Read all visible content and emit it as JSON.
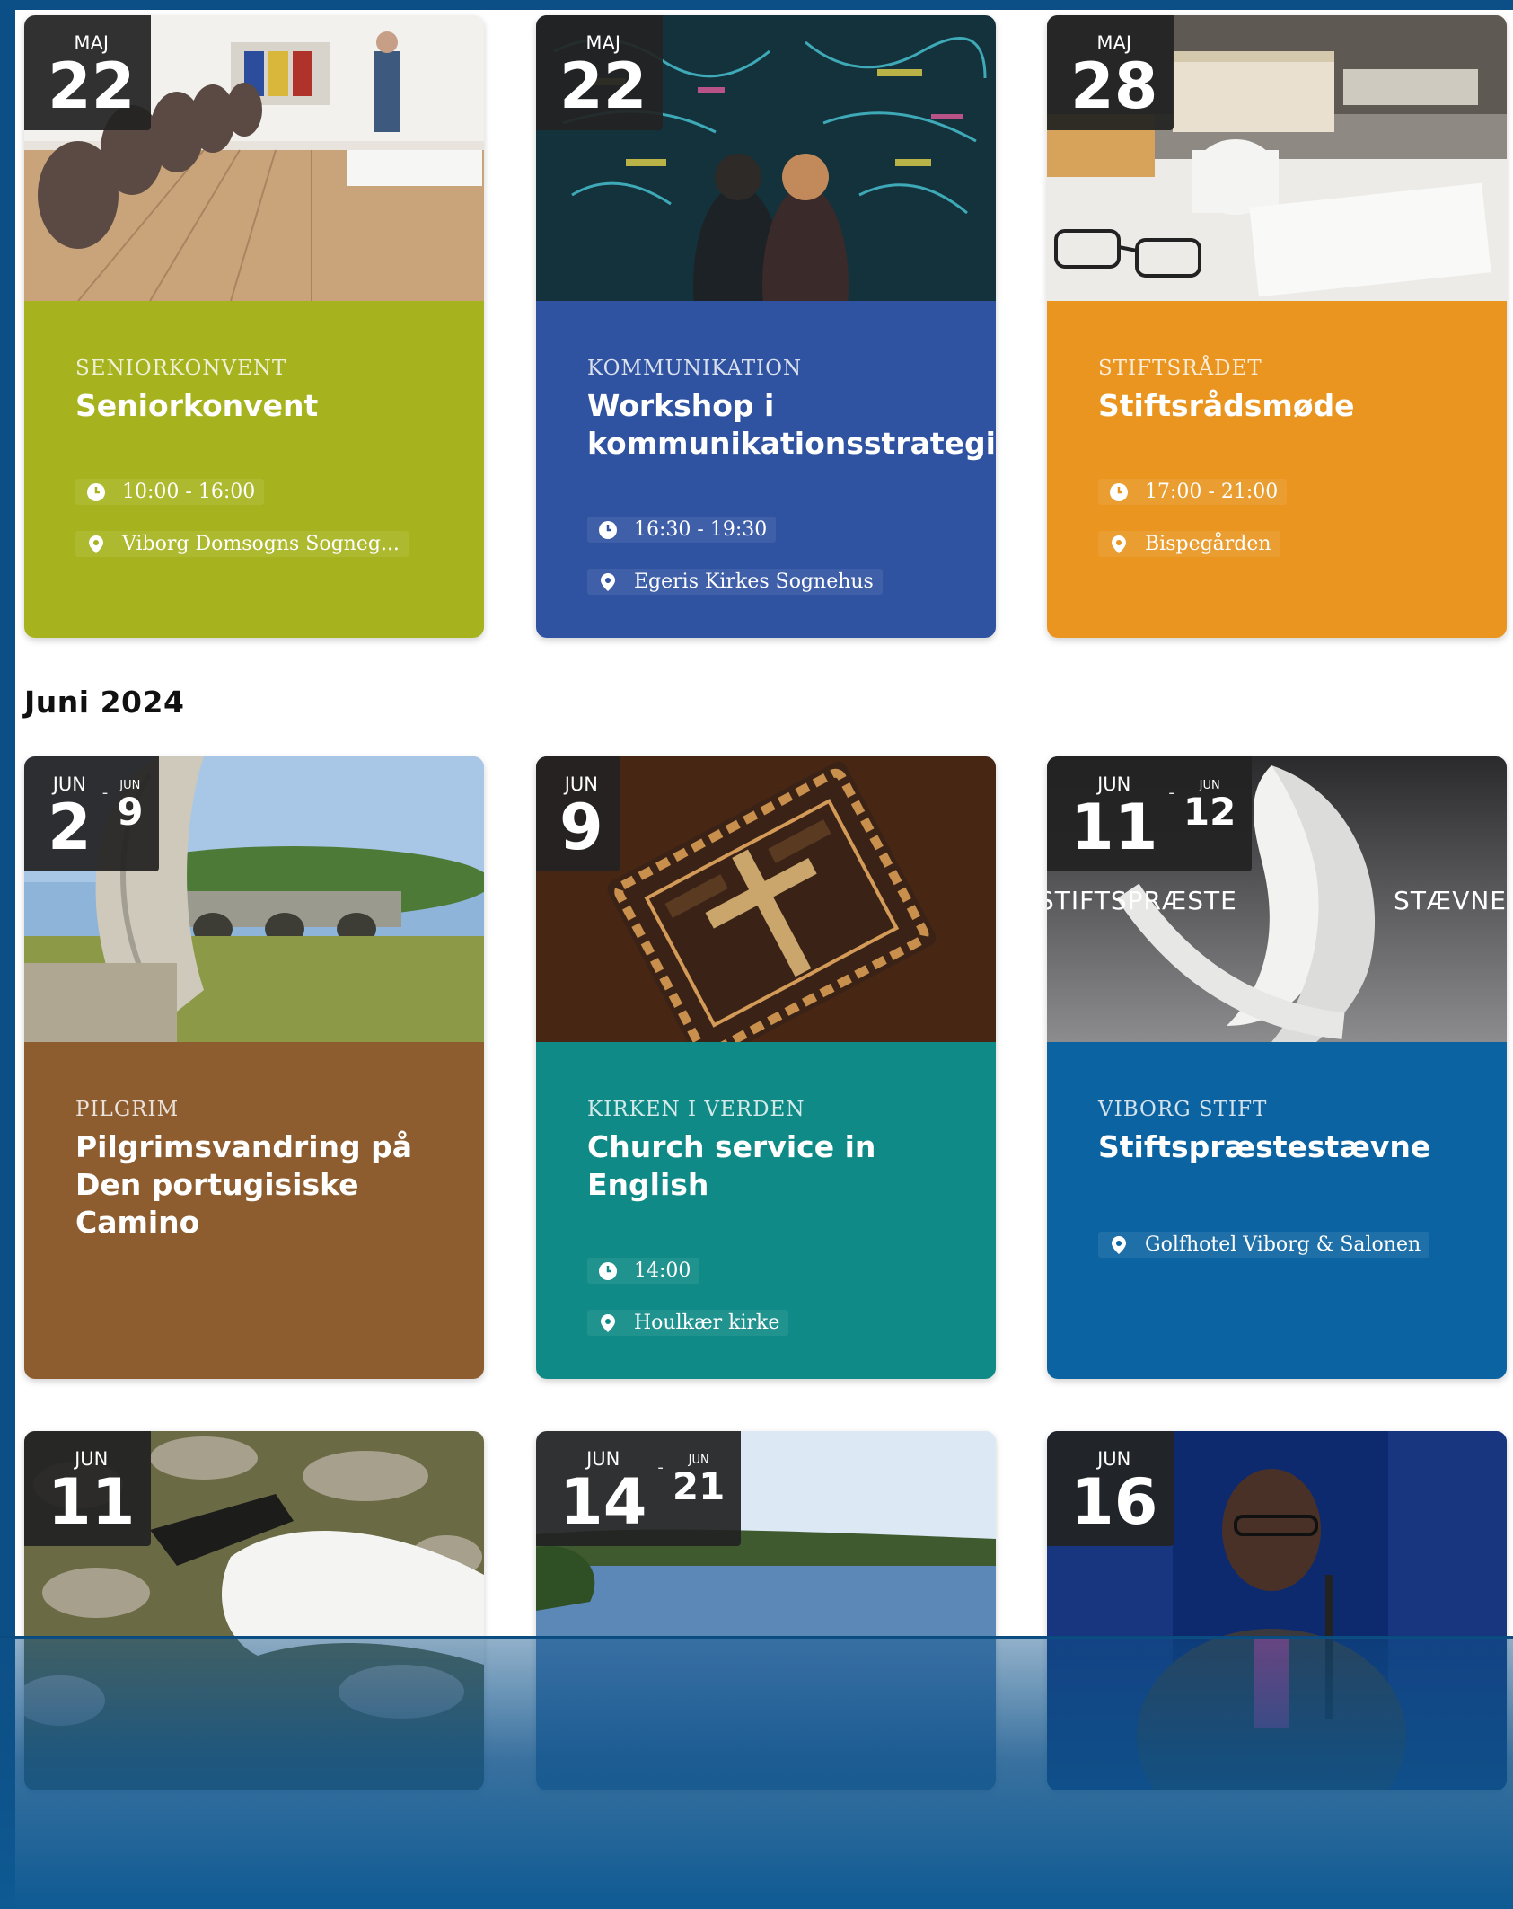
{
  "month_heading": "Juni 2024",
  "cards": [
    {
      "badge": {
        "start_month": "MAJ",
        "start_day": "22"
      },
      "category": "SENIORKONVENT",
      "title": "Seniorkonvent",
      "time": "10:00 - 16:00",
      "location": "Viborg Domsogns Sogneg...",
      "color": "#a6b31e"
    },
    {
      "badge": {
        "start_month": "MAJ",
        "start_day": "22"
      },
      "category": "KOMMUNIKATION",
      "title": "Workshop i kommunikationsstrategi",
      "time": "16:30 - 19:30",
      "location": "Egeris Kirkes Sognehus",
      "color": "#2f52a1"
    },
    {
      "badge": {
        "start_month": "MAJ",
        "start_day": "28"
      },
      "category": "STIFTSRÅDET",
      "title": "Stiftsrådsmøde",
      "time": "17:00 - 21:00",
      "location": "Bispegården",
      "color": "#e9951f"
    },
    {
      "badge": {
        "start_month": "JUN",
        "start_day": "2",
        "end_month": "JUN",
        "end_day": "9"
      },
      "category": "PILGRIM",
      "title": "Pilgrimsvandring på Den portugisiske Camino",
      "color": "#8d5c2f"
    },
    {
      "badge": {
        "start_month": "JUN",
        "start_day": "9"
      },
      "category": "KIRKEN I VERDEN",
      "title": "Church service in English",
      "time": "14:00",
      "location": "Houlkær kirke",
      "color": "#0f8a86"
    },
    {
      "badge": {
        "start_month": "JUN",
        "start_day": "11",
        "end_month": "JUN",
        "end_day": "12"
      },
      "image_caption_left": "STIFTSPRÆSTE",
      "image_caption_right": "STÆVNE",
      "category": "VIBORG STIFT",
      "title": "Stiftspræstestævne",
      "location": "Golfhotel Viborg & Salonen",
      "color": "#0c63a1"
    },
    {
      "badge": {
        "start_month": "JUN",
        "start_day": "11"
      }
    },
    {
      "badge": {
        "start_month": "JUN",
        "start_day": "14",
        "end_month": "JUN",
        "end_day": "21"
      }
    },
    {
      "badge": {
        "start_month": "JUN",
        "start_day": "16"
      }
    }
  ]
}
